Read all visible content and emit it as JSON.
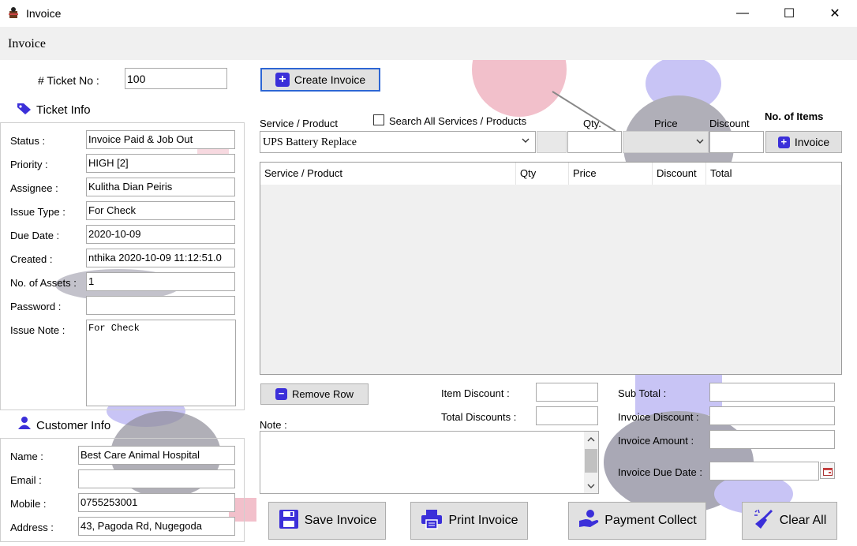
{
  "window": {
    "title": "Invoice",
    "minimize": "—",
    "maximize": "☐",
    "close": "✕"
  },
  "header": {
    "title": "Invoice"
  },
  "ticket": {
    "label": "# Ticket No :",
    "value": "100"
  },
  "create_invoice": {
    "label": "Create Invoice"
  },
  "ticket_info": {
    "heading": "Ticket Info",
    "fields": [
      {
        "label": "Status :",
        "value": "Invoice Paid & Job Out"
      },
      {
        "label": "Priority :",
        "value": "HIGH [2]"
      },
      {
        "label": "Assignee :",
        "value": "Kulitha Dian Peiris"
      },
      {
        "label": "Issue Type :",
        "value": "For Check"
      },
      {
        "label": "Due Date :",
        "value": "2020-10-09"
      },
      {
        "label": "Created :",
        "value": "nthika 2020-10-09 11:12:51.0"
      },
      {
        "label": "No. of Assets :",
        "value": "1"
      },
      {
        "label": "Password :",
        "value": ""
      }
    ],
    "issue_note": {
      "label": "Issue Note :",
      "value": "For Check"
    }
  },
  "customer_info": {
    "heading": "Customer Info",
    "fields": [
      {
        "label": "Name :",
        "value": "Best Care Animal Hospital"
      },
      {
        "label": "Email :",
        "value": ""
      },
      {
        "label": "Mobile :",
        "value": "0755253001"
      },
      {
        "label": "Address :",
        "value": "43, Pagoda Rd, Nugegoda"
      }
    ]
  },
  "entry": {
    "service_label": "Service / Product",
    "search_all_label": "Search All Services / Products",
    "qty_label": "Qty.",
    "price_label": "Price",
    "discount_label": "Discount",
    "no_items_label": "No. of Items",
    "service_value": "UPS Battery Replace",
    "add_button": "Invoice"
  },
  "table": {
    "columns": [
      "Service / Product",
      "Qty",
      "Price",
      "Discount",
      "Total"
    ],
    "rows": []
  },
  "remove_row": {
    "label": "Remove Row"
  },
  "note": {
    "label": "Note :",
    "value": ""
  },
  "discounts": {
    "item_label": "Item Discount :",
    "total_label": "Total Discounts :"
  },
  "totals": {
    "sub_total_label": "Sub Total :",
    "invoice_discount_label": "Invoice Discount :",
    "invoice_amount_label": "Invoice Amount :",
    "invoice_due_label": "Invoice Due Date :"
  },
  "actions": {
    "save": "Save Invoice",
    "print": "Print Invoice",
    "payment": "Payment Collect",
    "clear": "Clear All"
  },
  "colors": {
    "accent": "#3b2fd9",
    "watermark_pink": "#f2c0cb",
    "watermark_blue": "#c8c4f5",
    "watermark_grey": "#a9a8b5"
  }
}
